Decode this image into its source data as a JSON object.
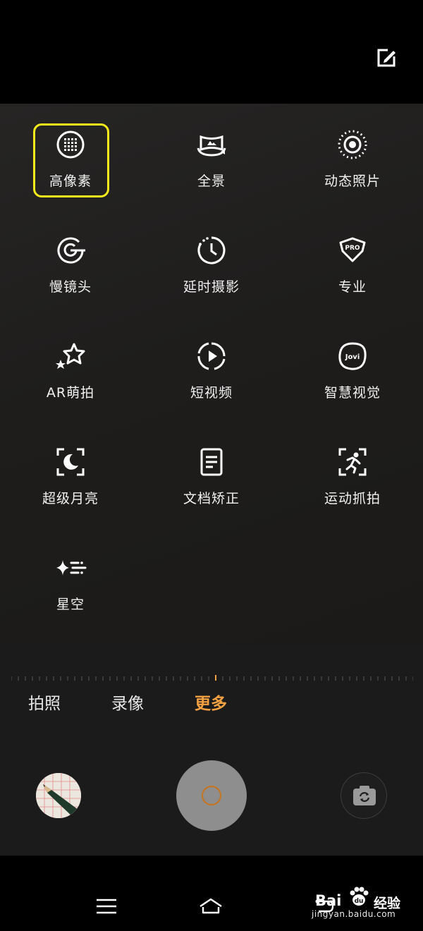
{
  "colors": {
    "accent": "#f5a142",
    "highlight": "#f5ea1a",
    "panel_bg": "#1e1d1c",
    "shutter": "#8f8e8e"
  },
  "header": {
    "edit_icon": "edit-icon"
  },
  "modes": [
    {
      "label": "高像素",
      "icon": "high-pixel-icon",
      "selected": true
    },
    {
      "label": "全景",
      "icon": "panorama-icon"
    },
    {
      "label": "动态照片",
      "icon": "live-photo-icon"
    },
    {
      "label": "慢镜头",
      "icon": "slow-motion-icon"
    },
    {
      "label": "延时摄影",
      "icon": "timelapse-icon"
    },
    {
      "label": "专业",
      "icon": "pro-icon"
    },
    {
      "label": "AR萌拍",
      "icon": "ar-stars-icon"
    },
    {
      "label": "短视频",
      "icon": "short-video-icon"
    },
    {
      "label": "智慧视觉",
      "icon": "jovi-icon"
    },
    {
      "label": "超级月亮",
      "icon": "super-moon-icon"
    },
    {
      "label": "文档矫正",
      "icon": "document-icon"
    },
    {
      "label": "运动抓拍",
      "icon": "sport-icon"
    },
    {
      "label": "星空",
      "icon": "starry-sky-icon"
    }
  ],
  "tabs": [
    {
      "label": "拍照"
    },
    {
      "label": "录像"
    },
    {
      "label": "更多",
      "active": true
    }
  ],
  "controls": {
    "gallery": "gallery-thumbnail",
    "shutter": "shutter-button",
    "switch": "camera-switch-icon"
  },
  "watermark": {
    "logo": "Bai",
    "cn": "经验",
    "url": "jingyan.baidu.com"
  }
}
